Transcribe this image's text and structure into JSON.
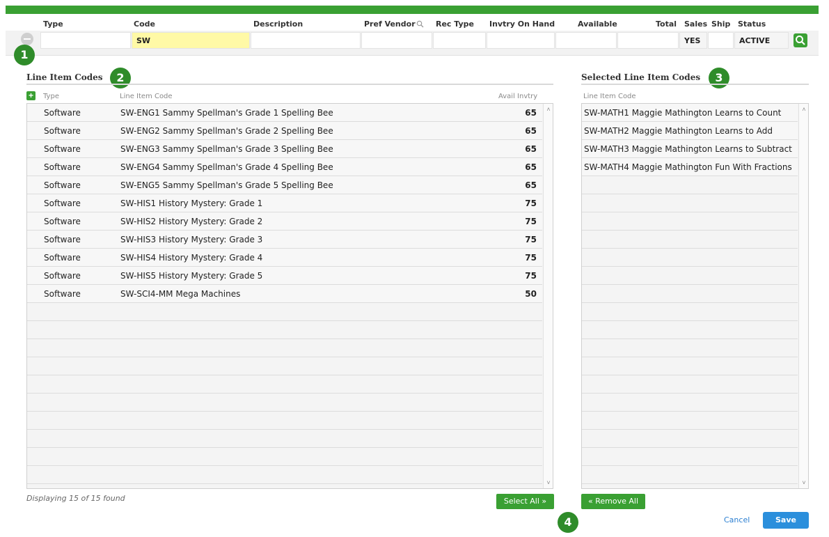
{
  "filter": {
    "headers": {
      "type": "Type",
      "code": "Code",
      "description": "Description",
      "pref_vendor": "Pref Vendor",
      "rec_type": "Rec Type",
      "invtry_on_hand": "Invtry On Hand",
      "available": "Available",
      "total": "Total",
      "sales": "Sales",
      "ship": "Ship",
      "status": "Status"
    },
    "values": {
      "code": "SW",
      "sales": "YES",
      "status": "ACTIVE"
    }
  },
  "badges": [
    "1",
    "2",
    "3",
    "4"
  ],
  "left": {
    "title": "Line Item Codes",
    "col_type": "Type",
    "col_code": "Line Item Code",
    "col_avail": "Avail Invtry",
    "rows": [
      {
        "type": "Software",
        "code": "SW-ENG1 Sammy Spellman's Grade 1 Spelling Bee",
        "avail": "65"
      },
      {
        "type": "Software",
        "code": "SW-ENG2 Sammy Spellman's Grade 2 Spelling Bee",
        "avail": "65"
      },
      {
        "type": "Software",
        "code": "SW-ENG3 Sammy Spellman's Grade 3 Spelling Bee",
        "avail": "65"
      },
      {
        "type": "Software",
        "code": "SW-ENG4 Sammy Spellman's Grade 4 Spelling Bee",
        "avail": "65"
      },
      {
        "type": "Software",
        "code": "SW-ENG5 Sammy Spellman's Grade 5 Spelling Bee",
        "avail": "65"
      },
      {
        "type": "Software",
        "code": "SW-HIS1 History Mystery: Grade 1",
        "avail": "75"
      },
      {
        "type": "Software",
        "code": "SW-HIS2 History Mystery: Grade 2",
        "avail": "75"
      },
      {
        "type": "Software",
        "code": "SW-HIS3 History Mystery: Grade 3",
        "avail": "75"
      },
      {
        "type": "Software",
        "code": "SW-HIS4 History Mystery: Grade 4",
        "avail": "75"
      },
      {
        "type": "Software",
        "code": "SW-HIS5 History Mystery: Grade 5",
        "avail": "75"
      },
      {
        "type": "Software",
        "code": "SW-SCI4-MM Mega Machines",
        "avail": "50"
      }
    ],
    "footer": "Displaying 15 of 15 found",
    "select_all": "Select All »"
  },
  "right": {
    "title": "Selected Line Item Codes",
    "col_code": "Line Item Code",
    "rows": [
      {
        "code": "SW-MATH1 Maggie Mathington Learns to Count"
      },
      {
        "code": "SW-MATH2 Maggie Mathington Learns to Add"
      },
      {
        "code": "SW-MATH3 Maggie Mathington Learns to Subtract"
      },
      {
        "code": "SW-MATH4 Maggie Mathington Fun With Fractions"
      }
    ],
    "remove_all": "« Remove All"
  },
  "actions": {
    "cancel": "Cancel",
    "save": "Save"
  },
  "colors": {
    "brand_green": "#3aa033",
    "badge_green": "#2f8c2a",
    "save_blue": "#2b8fdc",
    "code_highlight": "#fff9a6"
  },
  "icons": {
    "filter_search": "magnifier-icon",
    "remove_filter": "minus-circle-icon",
    "add_row": "plus-icon"
  }
}
